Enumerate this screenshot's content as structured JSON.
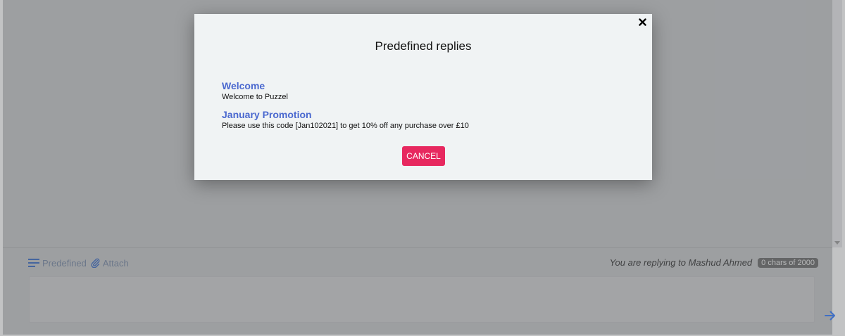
{
  "composer": {
    "predefined_label": "Predefined",
    "attach_label": "Attach",
    "reply_info": "You are replying to Mashud Ahmed",
    "char_count": "0 chars of 2000",
    "input_value": "",
    "input_placeholder": ""
  },
  "modal": {
    "title": "Predefined replies",
    "replies": [
      {
        "title": "Welcome",
        "text": "Welcome to Puzzel"
      },
      {
        "title": "January Promotion",
        "text": "Please use this code [Jan102021] to get 10% off any purchase over £10"
      }
    ],
    "cancel_label": "CANCEL"
  },
  "icons": {
    "predefined": "lines-icon",
    "attach": "paperclip-icon",
    "send": "arrow-right-icon",
    "close": "close-icon"
  },
  "colors": {
    "accent_blue": "#4a68cf",
    "cancel_pink": "#e7285f",
    "send_blue": "#3f6fc5"
  }
}
